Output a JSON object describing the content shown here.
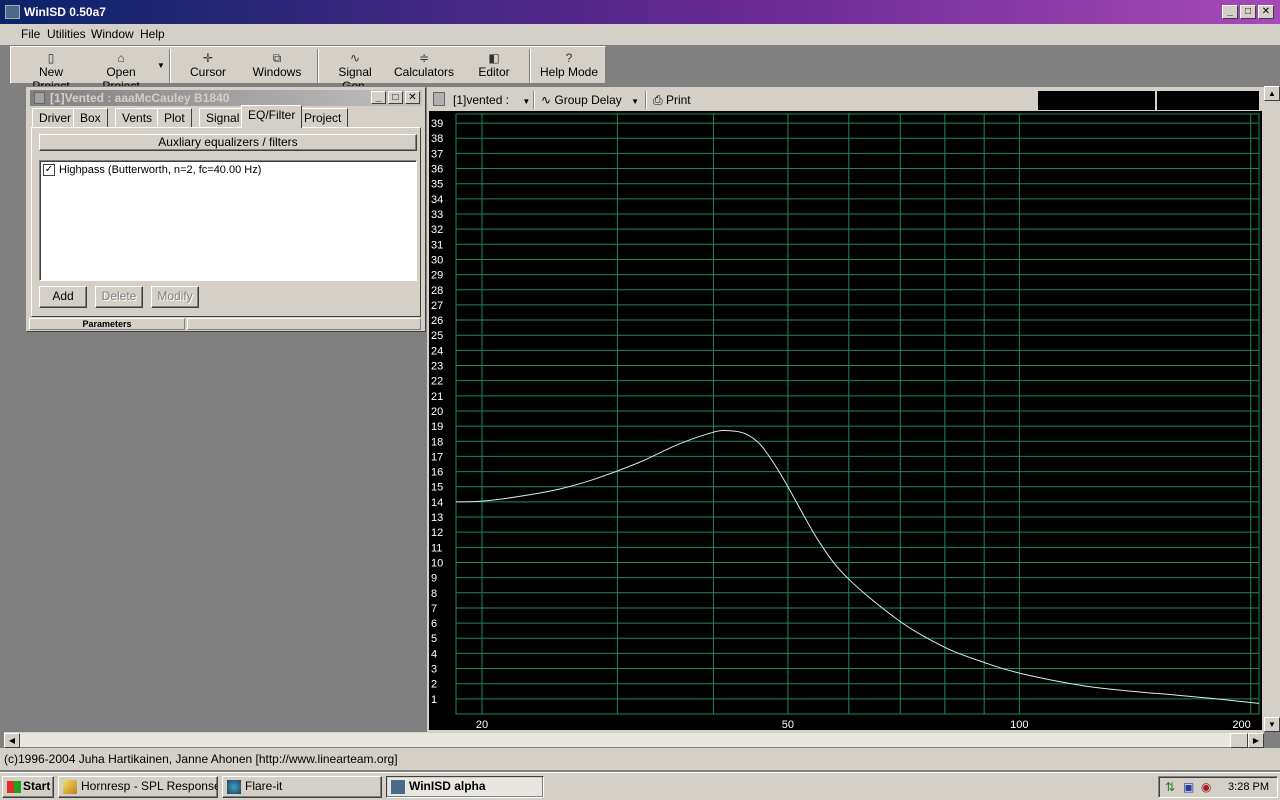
{
  "app": {
    "title": "WinISD 0.50a7"
  },
  "menu": [
    "File",
    "Utilities",
    "Window",
    "Help"
  ],
  "toolbar": {
    "new_project": "New Project",
    "open_project": "Open Project",
    "cursor": "Cursor",
    "windows": "Windows",
    "signal_gen": "Signal Gen.",
    "calculators": "Calculators",
    "editor": "Editor",
    "help_mode": "Help Mode"
  },
  "project_window": {
    "title": "[1]Vented : aaaMcCauley B1840",
    "tabs": [
      "Driver",
      "Box",
      "Vents",
      "Plot",
      "Signal",
      "EQ/Filter",
      "Project"
    ],
    "active_tab": "EQ/Filter",
    "header": "Auxliary equalizers / filters",
    "filters": [
      {
        "label": "Highpass (Butterworth, n=2, fc=40.00 Hz)",
        "checked": true
      }
    ],
    "add": "Add",
    "delete": "Delete",
    "modify": "Modify",
    "params_label": "Parameters"
  },
  "graph_window": {
    "project_select": "[1]vented :",
    "graph_select": "Group Delay",
    "print": "Print"
  },
  "chart_data": {
    "type": "line",
    "title": "",
    "xlabel": "",
    "ylabel": "",
    "x_scale": "log",
    "xlim": [
      18.5,
      205
    ],
    "ylim": [
      0,
      39.6
    ],
    "x_ticks": [
      20,
      50,
      100,
      200
    ],
    "y_ticks": [
      1,
      2,
      3,
      4,
      5,
      6,
      7,
      8,
      9,
      10,
      11,
      12,
      13,
      14,
      15,
      16,
      17,
      18,
      19,
      20,
      21,
      22,
      23,
      24,
      25,
      26,
      27,
      28,
      29,
      30,
      31,
      32,
      33,
      34,
      35,
      36,
      37,
      38,
      39
    ],
    "x_gridlines": [
      20,
      30,
      40,
      50,
      60,
      70,
      80,
      90,
      100,
      200
    ],
    "grid": true,
    "grid_color": "#1a8a5a",
    "line_color": "#d8f0e0",
    "series": [
      {
        "x": [
          18.5,
          20,
          22,
          25,
          28,
          32,
          36,
          40,
          42,
          44,
          46,
          48,
          50,
          55,
          60,
          70,
          80,
          90,
          100,
          120,
          140,
          160,
          180,
          205
        ],
        "values": [
          14.0,
          14.05,
          14.3,
          14.8,
          15.5,
          16.6,
          17.8,
          18.6,
          18.7,
          18.5,
          17.8,
          16.5,
          15.0,
          11.3,
          8.9,
          6.1,
          4.4,
          3.4,
          2.7,
          1.9,
          1.5,
          1.25,
          1.0,
          0.7
        ]
      }
    ]
  },
  "status": {
    "text": "(c)1996-2004 Juha Hartikainen, Janne Ahonen [http://www.linearteam.org]"
  },
  "taskbar": {
    "start": "Start",
    "items": [
      "Hornresp - SPL Response",
      "Flare-it",
      "WinISD alpha"
    ],
    "clock": "3:28 PM"
  }
}
